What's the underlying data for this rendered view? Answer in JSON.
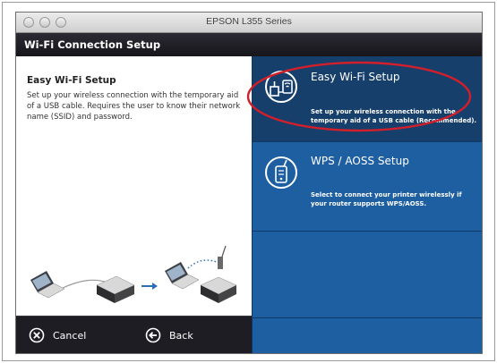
{
  "window": {
    "title": "EPSON L355 Series"
  },
  "header": {
    "title": "Wi-Fi Connection Setup"
  },
  "left_panel": {
    "title": "Easy Wi-Fi Setup",
    "description": "Set up your wireless connection with the temporary aid of a USB cable. Requires the user to know their network name (SSID) and password."
  },
  "options": [
    {
      "title": "Easy Wi-Fi Setup",
      "description": "Set up your wireless connection with the temporary aid of a USB cable (Recommended).",
      "icon": "usb-wifi-icon",
      "selected": true
    },
    {
      "title": "WPS / AOSS Setup",
      "description": "Select to connect your printer wirelessly if your router supports WPS/AOSS.",
      "icon": "router-icon",
      "selected": false
    }
  ],
  "footer": {
    "cancel_label": "Cancel",
    "back_label": "Back"
  },
  "colors": {
    "selected_option_bg": "#173f6b",
    "option_bg": "#1e5fa2",
    "highlight_oval": "#d21f2b",
    "header_bg": "#1f1d24"
  }
}
